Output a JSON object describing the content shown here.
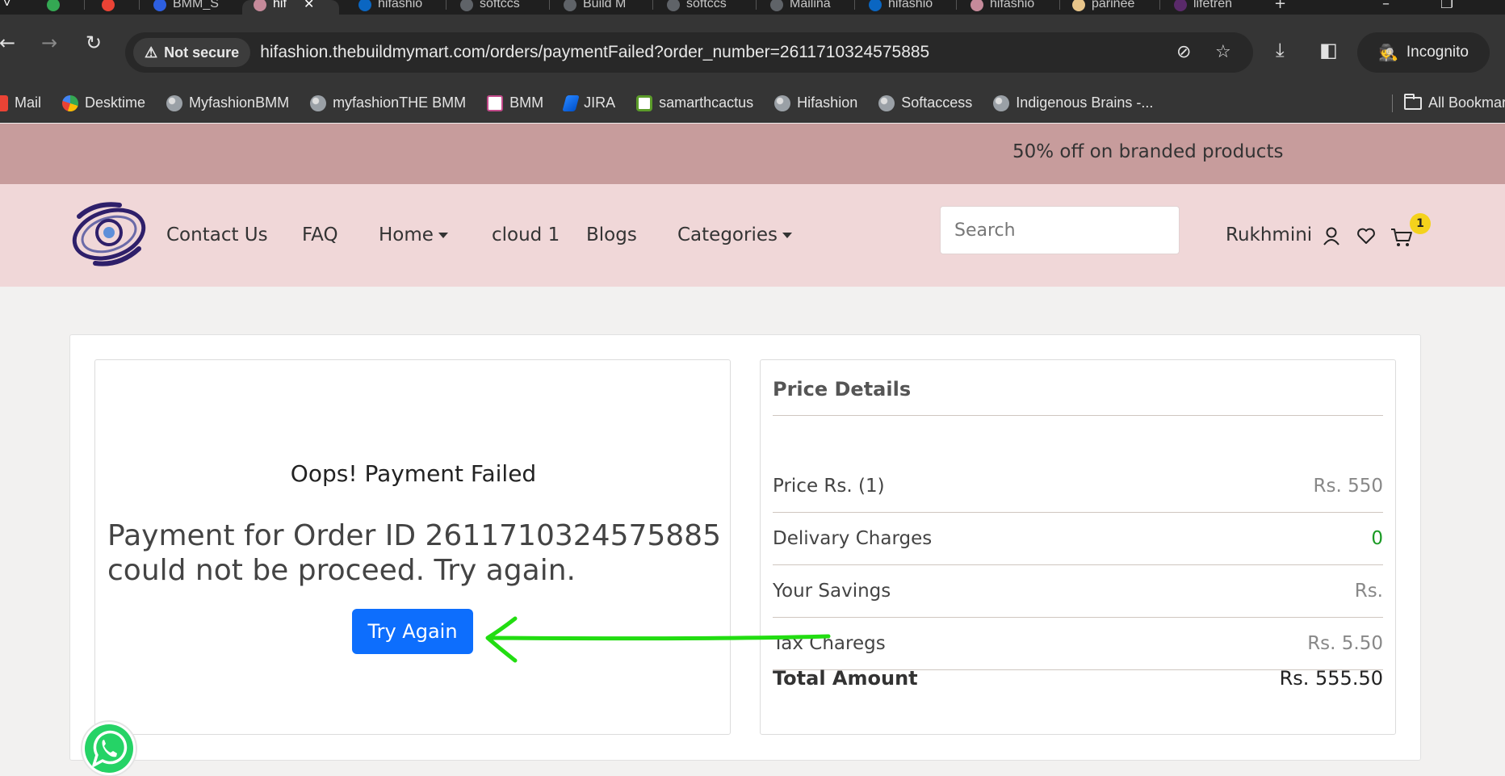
{
  "browser": {
    "tabs": [
      {
        "label": ""
      },
      {
        "label": ""
      },
      {
        "label": "BMM_S"
      },
      {
        "label": "hif"
      },
      {
        "label": "hifashio"
      },
      {
        "label": "softccs"
      },
      {
        "label": "Build M"
      },
      {
        "label": "softccs"
      },
      {
        "label": "Mailina"
      },
      {
        "label": "hifashio"
      },
      {
        "label": "hifashio"
      },
      {
        "label": "parinee"
      },
      {
        "label": "lifetren"
      }
    ],
    "security_label": "Not secure",
    "url": "hifashion.thebuildmymart.com/orders/paymentFailed?order_number=2611710324575885",
    "incognito_label": "Incognito",
    "bookmarks": [
      {
        "label": "Mail"
      },
      {
        "label": "Desktime"
      },
      {
        "label": "MyfashionBMM"
      },
      {
        "label": "myfashionTHE BMM"
      },
      {
        "label": "BMM"
      },
      {
        "label": "JIRA"
      },
      {
        "label": "samarthcactus"
      },
      {
        "label": "Hifashion"
      },
      {
        "label": "Softaccess"
      },
      {
        "label": "Indigenous Brains -..."
      }
    ],
    "all_bookmarks_label": "All Bookmarks"
  },
  "site": {
    "promo_text": "50% off on branded products",
    "nav": {
      "contact": "Contact Us",
      "faq": "FAQ",
      "home": "Home",
      "cloud": "cloud 1",
      "blogs": "Blogs",
      "categories": "Categories"
    },
    "search_placeholder": "Search",
    "user_name": "Rukhmini",
    "cart_count": "1"
  },
  "payment": {
    "title": "Oops! Payment Failed",
    "message": "Payment for Order ID 2611710324575885 could not be proceed. Try again.",
    "try_again_label": "Try Again"
  },
  "price_details": {
    "title": "Price Details",
    "rows": [
      {
        "label": "Price Rs. (1)",
        "value": "Rs. 550"
      },
      {
        "label": "Delivary Charges",
        "value": "0"
      },
      {
        "label": "Your Savings",
        "value": "Rs."
      },
      {
        "label": "Tax Charegs",
        "value": "Rs. 5.50"
      }
    ],
    "total_label": "Total Amount",
    "total_value": "Rs. 555.50"
  },
  "colors": {
    "promo_bg": "#c79c9c",
    "header_bg": "#f0d7d8",
    "primary_button": "#0d6efd",
    "annotation_arrow": "#22dd11",
    "green_value": "#1a9a24"
  }
}
